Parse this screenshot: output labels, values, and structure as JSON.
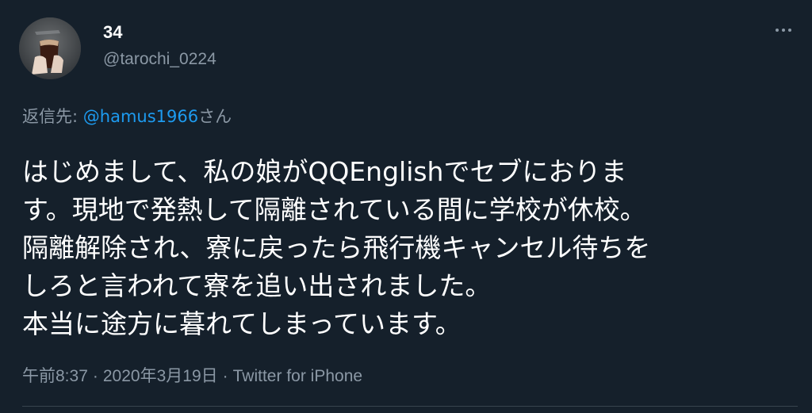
{
  "author": {
    "display_name": "34",
    "handle": "@tarochi_0224"
  },
  "more_icon": "more-horizontal-icon",
  "reply": {
    "prefix": "返信先: ",
    "mention": "@hamus1966",
    "suffix": "さん"
  },
  "tweet": {
    "lines": [
      "はじめまして、私の娘がQQEnglishでセブにおりま",
      "す。現地で発熱して隔離されている間に学校が休校。",
      "隔離解除され、寮に戻ったら飛行機キャンセル待ちを",
      "しろと言われて寮を追い出されました。",
      "本当に途方に暮れてしまっています。"
    ]
  },
  "meta": {
    "time": "午前8:37",
    "separator": "·",
    "date": "2020年3月19日",
    "source": "Twitter for iPhone"
  },
  "colors": {
    "background": "#15202b",
    "text": "#ffffff",
    "secondary": "#8b98a5",
    "link": "#1d9bf0"
  }
}
